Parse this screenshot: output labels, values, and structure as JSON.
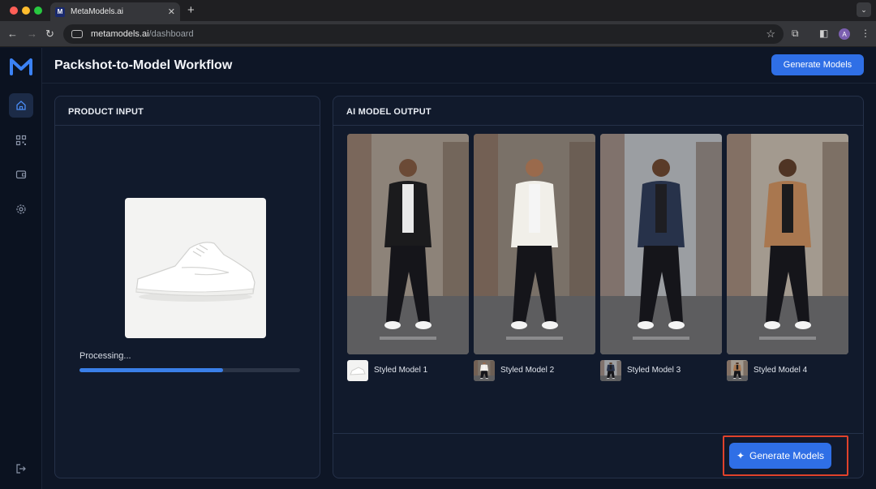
{
  "browser": {
    "tab_title": "MetaModels.ai",
    "tab_favicon": "M",
    "tab_close": "✕",
    "new_tab": "+",
    "url_host": "metamodels.ai",
    "url_path": "/dashboard",
    "profile_initial": "A"
  },
  "app": {
    "page_title": "Packshot-to-Model Workflow",
    "header_button": "Generate Models",
    "footer_button": "Generate Models"
  },
  "input_panel": {
    "title": "PRODUCT INPUT",
    "status": "Processing...",
    "progress": 0.65
  },
  "output_panel": {
    "title": "AI MODEL OUTPUT",
    "models": [
      {
        "label": "Styled Model 1",
        "coat": "#1b1b1d",
        "shirt": "#e9e9e9",
        "skin": "#6b4a36"
      },
      {
        "label": "Styled Model 2",
        "coat": "#f1efe9",
        "shirt": "#f5f5f5",
        "skin": "#9a6a4c"
      },
      {
        "label": "Styled Model 3",
        "coat": "#27324a",
        "shirt": "#1e1e22",
        "skin": "#5a3b28"
      },
      {
        "label": "Styled Model 4",
        "coat": "#a9774f",
        "shirt": "#1b1b1d",
        "skin": "#4f3424"
      }
    ]
  },
  "colors": {
    "accent": "#2f6fe6",
    "highlight": "#e0422b",
    "panel": "#111a2c",
    "background": "#0e1626"
  }
}
